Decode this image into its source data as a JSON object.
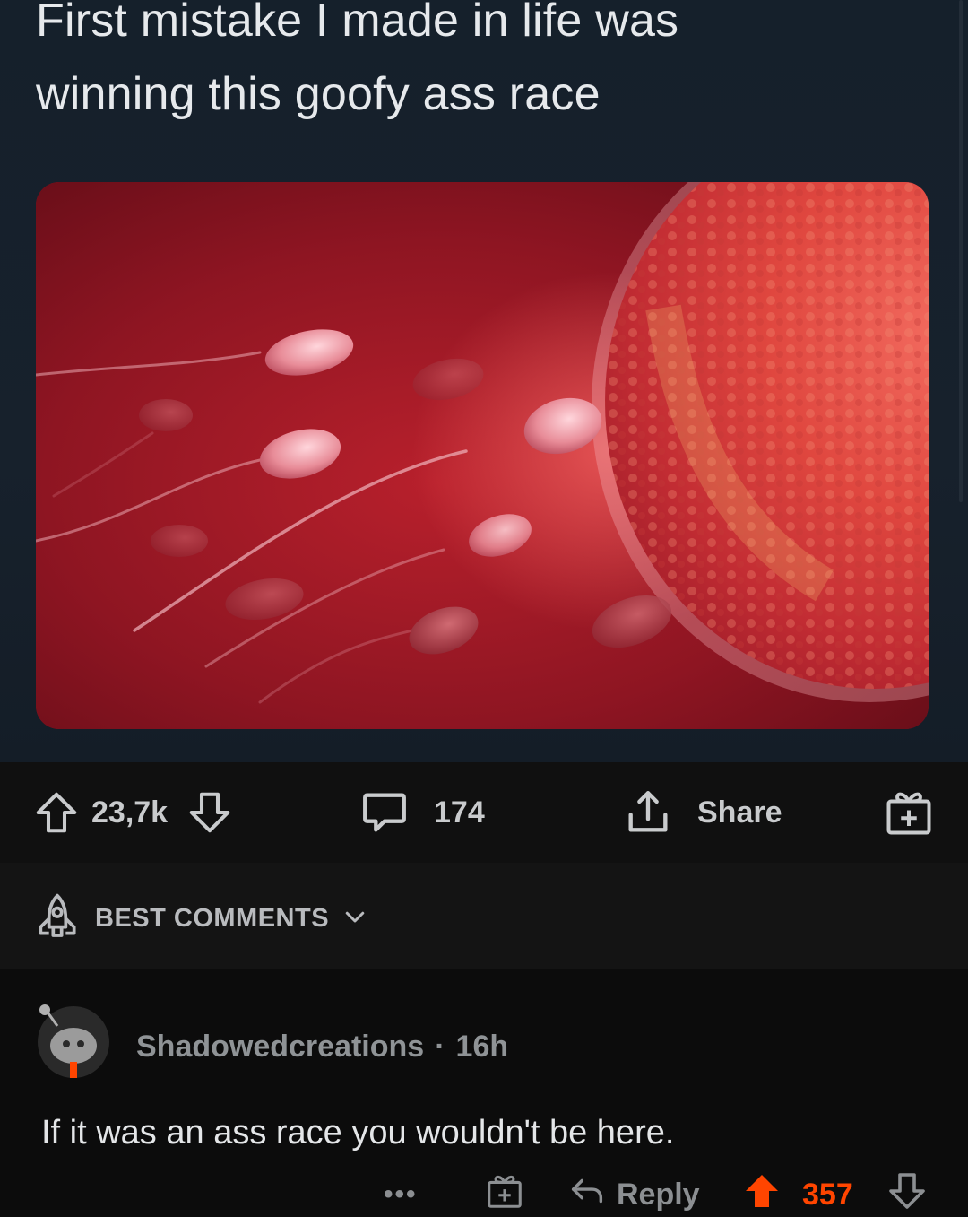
{
  "tweet": {
    "text": "First mistake I made in life was\nwinning this goofy ass race",
    "image_alt": "illustration of sperm cells swimming toward an egg"
  },
  "post_actions": {
    "upvote_count": "23,7k",
    "comment_count": "174",
    "share_label": "Share"
  },
  "sort": {
    "label": "BEST COMMENTS"
  },
  "comment": {
    "author": "Shadowedcreations",
    "separator": "·",
    "age": "16h",
    "body": "If it was an ass race you wouldn't be here.",
    "more_label": "•••",
    "reply_label": "Reply",
    "score": "357"
  },
  "colors": {
    "tweet_bg": "#15202b",
    "upvote_active": "#ff4500",
    "app_bg": "#0f0f0f"
  },
  "icons": {
    "upvote": "arrow-up-outline-icon",
    "downvote": "arrow-down-outline-icon",
    "comments": "speech-bubble-icon",
    "share": "share-upload-icon",
    "award": "gift-award-icon",
    "sort": "rocket-icon",
    "chevron": "chevron-down-icon",
    "reply": "reply-arrow-icon",
    "upvote_active": "arrow-up-filled-icon"
  }
}
